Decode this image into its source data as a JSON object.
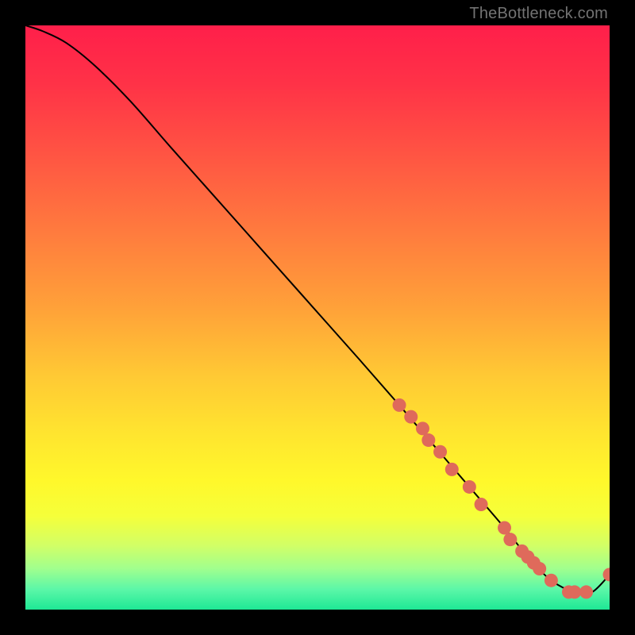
{
  "watermark": "TheBottleneck.com",
  "palette": {
    "black": "#000000",
    "curve": "#000000",
    "marker_fill": "#df6a5b",
    "marker_stroke": "#c55547"
  },
  "chart_data": {
    "type": "line",
    "title": "",
    "xlabel": "",
    "ylabel": "",
    "xlim": [
      0,
      100
    ],
    "ylim": [
      0,
      100
    ],
    "gradient_stops": [
      {
        "offset": 0.0,
        "color": "#ff1f4a"
      },
      {
        "offset": 0.1,
        "color": "#ff3247"
      },
      {
        "offset": 0.22,
        "color": "#ff5443"
      },
      {
        "offset": 0.35,
        "color": "#ff7a3e"
      },
      {
        "offset": 0.48,
        "color": "#ffa039"
      },
      {
        "offset": 0.6,
        "color": "#ffc934"
      },
      {
        "offset": 0.7,
        "color": "#ffe52f"
      },
      {
        "offset": 0.78,
        "color": "#fff82b"
      },
      {
        "offset": 0.84,
        "color": "#f5ff3a"
      },
      {
        "offset": 0.89,
        "color": "#d2ff66"
      },
      {
        "offset": 0.93,
        "color": "#a0ff8e"
      },
      {
        "offset": 0.965,
        "color": "#5cf7a8"
      },
      {
        "offset": 1.0,
        "color": "#1ee895"
      }
    ],
    "series": [
      {
        "name": "bottleneck-curve",
        "x": [
          0,
          3,
          7,
          12,
          18,
          25,
          33,
          41,
          49,
          57,
          64,
          70,
          76,
          82,
          86,
          90,
          94,
          97,
          100
        ],
        "y": [
          100,
          99,
          97,
          93,
          87,
          79,
          70,
          61,
          52,
          43,
          35,
          28,
          21,
          14,
          9,
          5,
          3,
          3,
          6
        ]
      }
    ],
    "markers": {
      "name": "highlighted-points",
      "x": [
        64,
        66,
        68,
        69,
        71,
        73,
        76,
        78,
        82,
        83,
        85,
        86,
        87,
        88,
        90,
        93,
        94,
        96,
        100
      ],
      "y": [
        35,
        33,
        31,
        29,
        27,
        24,
        21,
        18,
        14,
        12,
        10,
        9,
        8,
        7,
        5,
        3,
        3,
        3,
        6
      ]
    }
  }
}
